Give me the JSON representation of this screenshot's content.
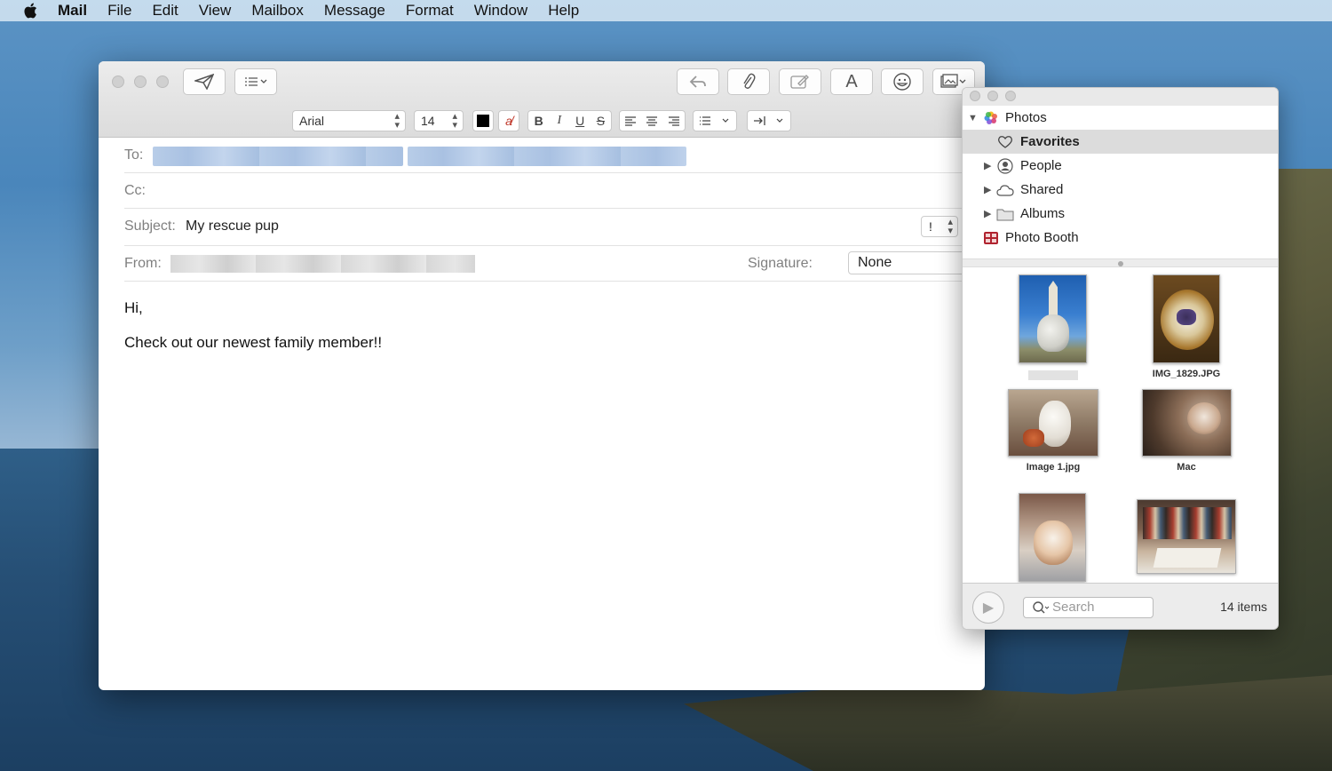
{
  "menubar": {
    "apple_icon": "apple-logo-icon",
    "items": [
      "Mail",
      "File",
      "Edit",
      "View",
      "Mailbox",
      "Message",
      "Format",
      "Window",
      "Help"
    ]
  },
  "compose": {
    "font": "Arial",
    "size": "14",
    "bold": "B",
    "italic": "I",
    "underline": "U",
    "strike": "S",
    "to_label": "To:",
    "cc_label": "Cc:",
    "subject_label": "Subject:",
    "subject_value": "My rescue pup",
    "priority": "!",
    "from_label": "From:",
    "signature_label": "Signature:",
    "signature_value": "None",
    "body_line1": "Hi,",
    "body_line2": "Check out our newest family member!!"
  },
  "photos": {
    "tree": {
      "root": "Photos",
      "favorites": "Favorites",
      "people": "People",
      "shared": "Shared",
      "albums": "Albums",
      "photo_booth": "Photo Booth"
    },
    "captions": {
      "c2": "IMG_1829.JPG",
      "c3": "Image 1.jpg",
      "c4": "Mac"
    },
    "search_placeholder": "Search",
    "count": "14 items"
  }
}
